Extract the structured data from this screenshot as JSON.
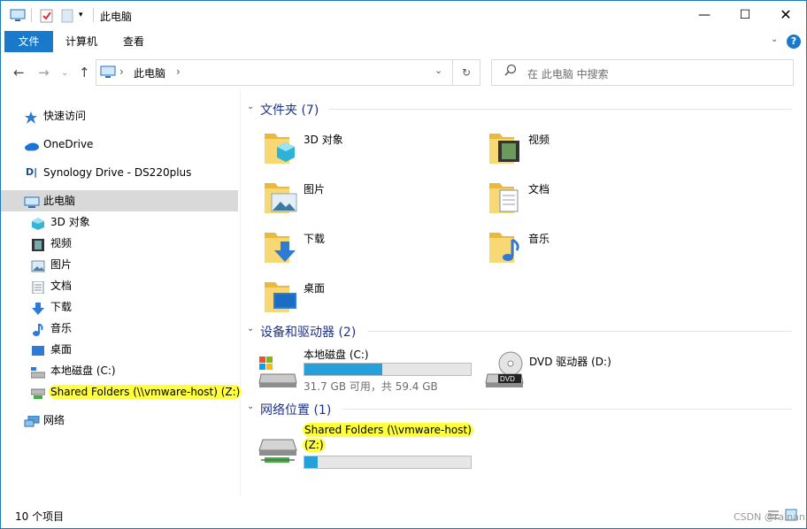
{
  "window": {
    "title": "此电脑"
  },
  "ribbon": {
    "tabs": [
      "文件",
      "计算机",
      "查看"
    ]
  },
  "address": {
    "location": "此电脑"
  },
  "search": {
    "placeholder": "在 此电脑 中搜索"
  },
  "nav": {
    "items": [
      {
        "label": "快速访问",
        "icon": "star-icon"
      },
      {
        "label": "OneDrive",
        "icon": "cloud-icon"
      },
      {
        "label": "Synology Drive - DS220plus",
        "icon": "synology-icon"
      },
      {
        "label": "此电脑",
        "icon": "computer-icon"
      },
      {
        "label": "3D 对象",
        "icon": "cube-icon"
      },
      {
        "label": "视频",
        "icon": "film-icon"
      },
      {
        "label": "图片",
        "icon": "picture-icon"
      },
      {
        "label": "文档",
        "icon": "document-icon"
      },
      {
        "label": "下载",
        "icon": "download-icon"
      },
      {
        "label": "音乐",
        "icon": "music-icon"
      },
      {
        "label": "桌面",
        "icon": "desktop-icon"
      },
      {
        "label": "本地磁盘 (C:)",
        "icon": "drive-icon"
      },
      {
        "label": "Shared Folders (\\\\vmware-host) (Z:)",
        "icon": "network-drive-icon"
      },
      {
        "label": "网络",
        "icon": "network-icon"
      }
    ]
  },
  "content": {
    "folders_header": "文件夹 (7)",
    "folders": [
      {
        "label": "3D 对象"
      },
      {
        "label": "视频"
      },
      {
        "label": "图片"
      },
      {
        "label": "文档"
      },
      {
        "label": "下载"
      },
      {
        "label": "音乐"
      },
      {
        "label": "桌面"
      }
    ],
    "devices_header": "设备和驱动器 (2)",
    "drive_c": {
      "label": "本地磁盘 (C:)",
      "space": "31.7 GB 可用，共 59.4 GB",
      "used_fraction": 0.47
    },
    "dvd": {
      "label": "DVD 驱动器 (D:)",
      "badge": "DVD"
    },
    "network_header": "网络位置 (1)",
    "network_drive": {
      "label_line1": "Shared Folders (\\\\vmware-host)",
      "label_line2": "(Z:)",
      "used_fraction": 0.08
    }
  },
  "status": {
    "count": "10 个项目"
  },
  "watermark": "CSDN @rainan",
  "colors": {
    "accent": "#1979ca",
    "highlight": "#ffff3c",
    "bar_fill": "#26a0da",
    "header_text": "#1e3287"
  }
}
